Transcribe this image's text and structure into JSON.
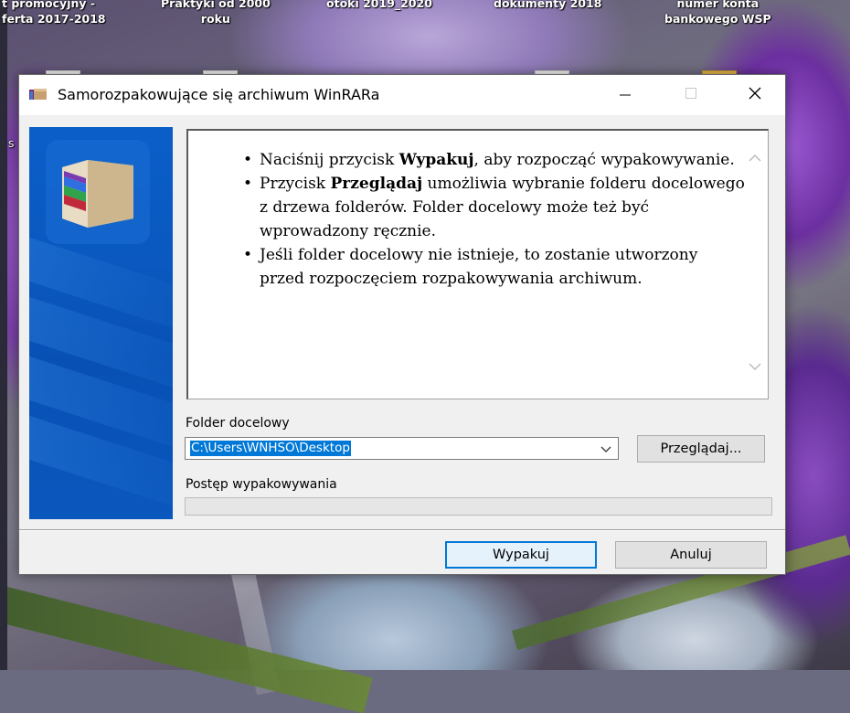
{
  "desktop": {
    "icons": [
      {
        "label_line1": "t promocyjny -",
        "label_line2": "ferta 2017-2018"
      },
      {
        "label_line1": "Praktyki od 2000",
        "label_line2": "roku"
      },
      {
        "label_line1": "otoki 2019_2020",
        "label_line2": ""
      },
      {
        "label_line1": "dokumenty 2018",
        "label_line2": ""
      },
      {
        "label_line1": "numer konta",
        "label_line2": "bankowego WSP"
      }
    ],
    "edge_letter": "s"
  },
  "window": {
    "title": "Samorozpakowujące się archiwum WinRARa",
    "icon": "winrar-archive-icon",
    "controls": {
      "minimize": "minimize-icon",
      "maximize": "maximize-icon",
      "close": "close-icon"
    }
  },
  "instructions": {
    "items": [
      {
        "before": "Naciśnij przycisk ",
        "bold": "Wypakuj",
        "after": ", aby rozpocząć wypakowywanie."
      },
      {
        "before": "Przycisk ",
        "bold": "Przeglądaj",
        "after": " umożliwia wybranie folderu docelowego z drzewa folderów. Folder docelowy może też być wprowadzony ręcznie."
      },
      {
        "before": "",
        "bold": "",
        "after": "Jeśli folder docelowy nie istnieje, to zostanie utworzony przed rozpoczęciem rozpakowywania archiwum."
      }
    ]
  },
  "form": {
    "folder_label": "Folder docelowy",
    "folder_value": "C:\\Users\\WNHSO\\Desktop",
    "browse_label": "Przeglądaj...",
    "progress_label": "Postęp wypakowywania",
    "progress_value": 0
  },
  "buttons": {
    "extract": "Wypakuj",
    "cancel": "Anuluj"
  },
  "colors": {
    "banner": "#0a58c0",
    "selection": "#0078d7",
    "default_button_border": "#0078d7"
  }
}
